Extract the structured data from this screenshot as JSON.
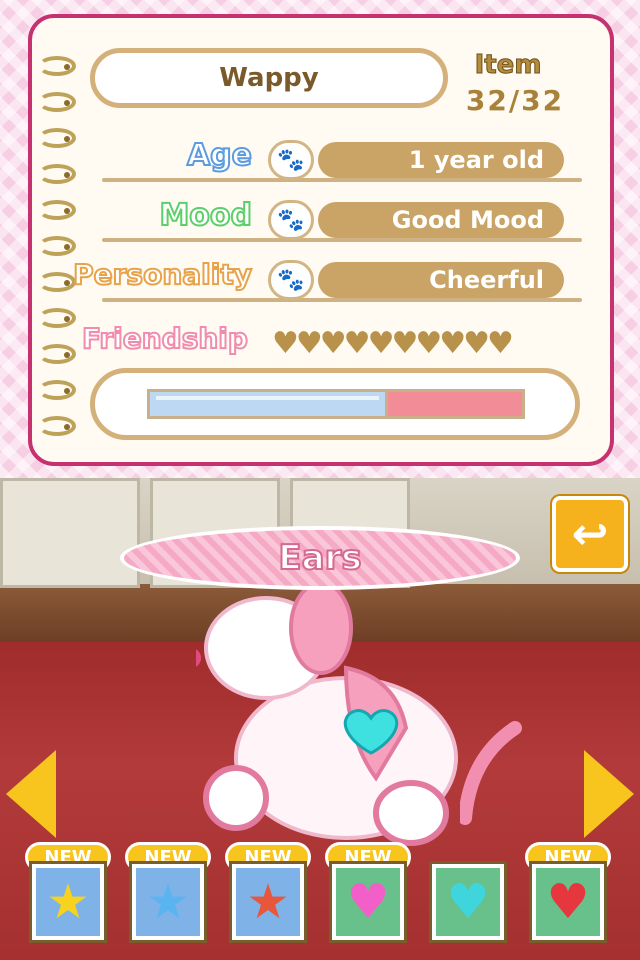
{
  "profile": {
    "pet_name": "Wappy",
    "item_label": "Item",
    "item_count": "32/32"
  },
  "stats": [
    {
      "label": "Age",
      "value": "1 year old",
      "label_color": "#5b9ce0"
    },
    {
      "label": "Mood",
      "value": "Good Mood",
      "label_color": "#5ccf6a"
    },
    {
      "label": "Personality",
      "value": "Cheerful",
      "label_color": "#e8a34a"
    }
  ],
  "friendship": {
    "label": "Friendship",
    "label_color": "#f08cae",
    "hearts": "♥♥♥♥♥♥♥♥♥♥",
    "bar_fill": 0.64
  },
  "scene": {
    "category_title": "Ears",
    "back_icon": "return-arrow-icon"
  },
  "items": [
    {
      "badge": "NEW",
      "icon": "★",
      "icon_name": "yellow-star-icon",
      "icon_color": "#f7d21e",
      "slot": "blue"
    },
    {
      "badge": "NEW",
      "icon": "★",
      "icon_name": "blue-star-icon",
      "icon_color": "#5ab4ef",
      "slot": "blue"
    },
    {
      "badge": "NEW",
      "icon": "★",
      "icon_name": "red-star-icon",
      "icon_color": "#e8563b",
      "slot": "blue"
    },
    {
      "badge": "NEW",
      "icon": "♥",
      "icon_name": "pink-heart-icon",
      "icon_color": "#f25fc8",
      "slot": "green"
    },
    {
      "badge": "",
      "icon": "♥",
      "icon_name": "cyan-heart-icon",
      "icon_color": "#3ed6dc",
      "slot": "green"
    },
    {
      "badge": "NEW",
      "icon": "♥",
      "icon_name": "red-heart-icon",
      "icon_color": "#e6373e",
      "slot": "green"
    }
  ]
}
